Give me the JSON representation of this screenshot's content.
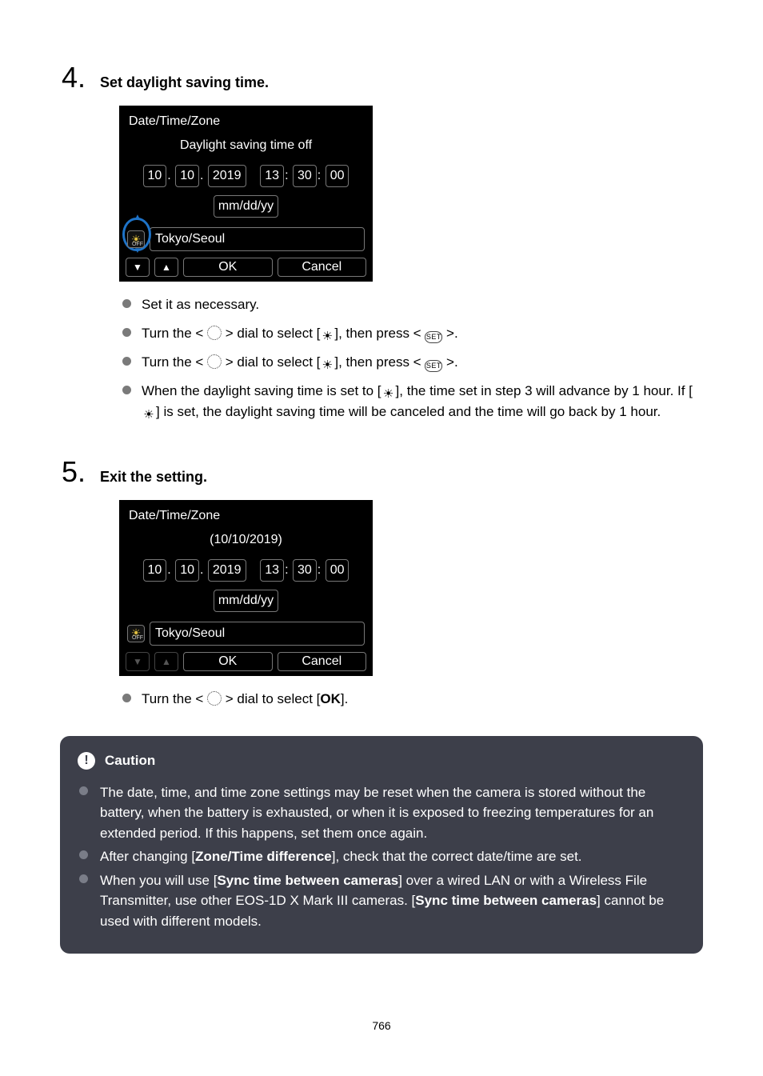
{
  "step4": {
    "num": "4.",
    "heading": "Set daylight saving time.",
    "screen": {
      "title": "Date/Time/Zone",
      "subtitle": "Daylight saving time off",
      "month": "10",
      "day": "10",
      "year": "2019",
      "hour": "13",
      "minute": "30",
      "second": "00",
      "format": "mm/dd/yy",
      "timezone": "Tokyo/Seoul",
      "ok": "OK",
      "cancel": "Cancel"
    },
    "notes": {
      "n1": "Set it as necessary.",
      "n2a": "Turn the < ",
      "n2b": " > dial to select [",
      "n2c": "], then press < ",
      "n2d": " >.",
      "n3a": "Turn the < ",
      "n3b": " > dial to select [",
      "n3c": "], then press < ",
      "n3d": " >.",
      "n4a": "When the daylight saving time is set to [",
      "n4b": "], the time set in step 3 will advance by 1 hour. If [",
      "n4c": "] is set, the daylight saving time will be canceled and the time will go back by 1 hour."
    }
  },
  "step5": {
    "num": "5.",
    "heading": "Exit the setting.",
    "screen": {
      "title": "Date/Time/Zone",
      "subtitle": "(10/10/2019)",
      "month": "10",
      "day": "10",
      "year": "2019",
      "hour": "13",
      "minute": "30",
      "second": "00",
      "format": "mm/dd/yy",
      "timezone": "Tokyo/Seoul",
      "ok": "OK",
      "cancel": "Cancel"
    },
    "notes": {
      "n1a": "Turn the < ",
      "n1b": " > dial to select [",
      "n1c": "OK",
      "n1d": "]."
    }
  },
  "caution": {
    "title": "Caution",
    "li1": "The date, time, and time zone settings may be reset when the camera is stored without the battery, when the battery is exhausted, or when it is exposed to freezing temperatures for an extended period. If this happens, set them once again.",
    "li2a": "After changing [",
    "li2bold": "Zone/Time difference",
    "li2b": "], check that the correct date/time are set.",
    "li3a": "When you will use [",
    "li3bold1": "Sync time between cameras",
    "li3b": "] over a wired LAN or with a Wireless File Transmitter, use other EOS-1D X Mark III cameras. [",
    "li3bold2": "Sync time between cameras",
    "li3c": "] cannot be used with different models."
  },
  "pageNumber": "766"
}
